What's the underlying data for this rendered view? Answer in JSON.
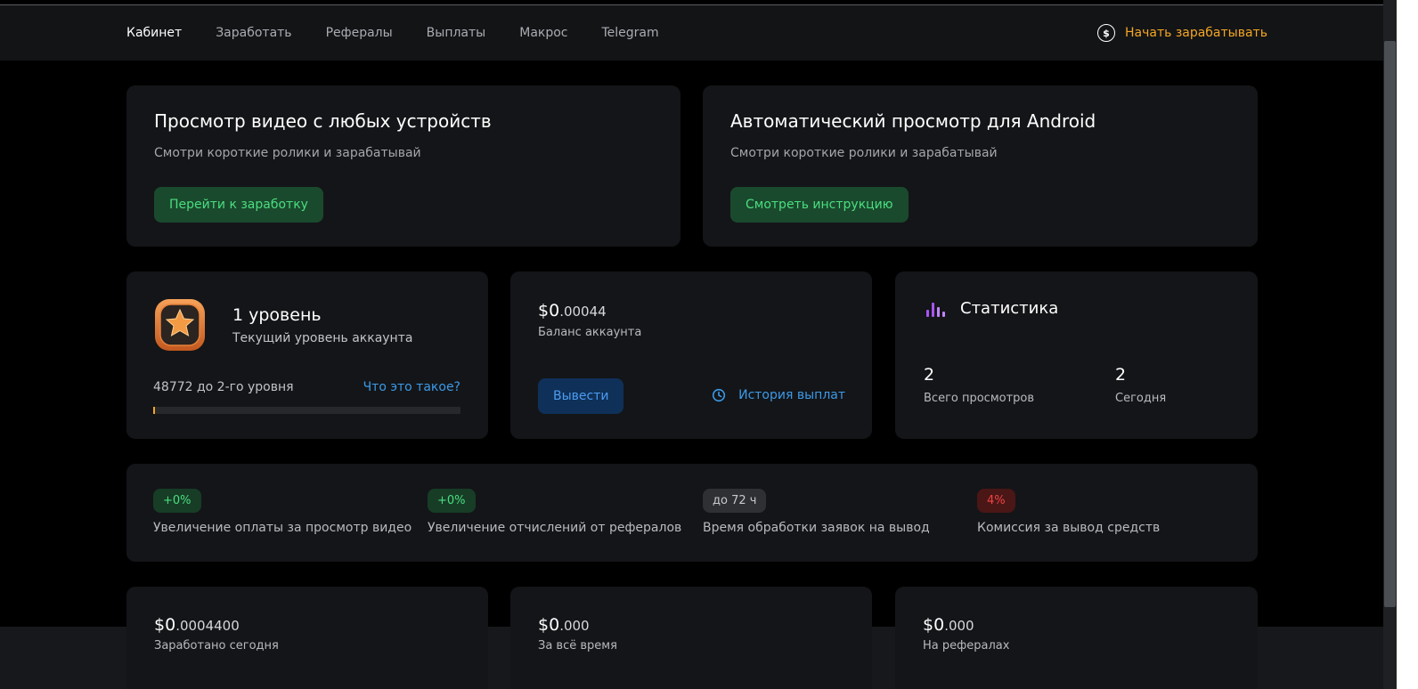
{
  "nav": {
    "items": [
      "Кабинет",
      "Заработать",
      "Рефералы",
      "Выплаты",
      "Макрос",
      "Telegram"
    ],
    "cta_label": "Начать зарабатывать",
    "cta_icon": "dollar-circle-icon"
  },
  "promo": [
    {
      "title": "Просмотр видео с любых устройств",
      "subtitle": "Смотри короткие ролики и зарабатывай",
      "button": "Перейти к заработку"
    },
    {
      "title": "Автоматический просмотр для Android",
      "subtitle": "Смотри короткие ролики и зарабатывай",
      "button": "Смотреть инструкцию"
    }
  ],
  "level": {
    "title": "1 уровень",
    "subtitle": "Текущий уровень аккаунта",
    "progress_text": "48772 до 2-го уровня",
    "help_link": "Что это такое?",
    "progress_fraction": 0.004,
    "icon": "star-badge-icon"
  },
  "balance": {
    "main": "$0",
    "frac": ".00044",
    "label": "Баланс аккаунта",
    "withdraw": "Вывести",
    "history": "История выплат"
  },
  "stats": {
    "title": "Статистика",
    "total_views": "2",
    "total_views_label": "Всего просмотров",
    "today": "2",
    "today_label": "Сегодня"
  },
  "features": [
    {
      "badge": "+0%",
      "label": "Увеличение оплаты за просмотр видео"
    },
    {
      "badge": "+0%",
      "label": "Увеличение отчислений от рефералов"
    },
    {
      "badge": "до 72 ч",
      "label": "Время обработки заявок на вывод"
    },
    {
      "badge": "4%",
      "label": "Комиссия за вывод средств"
    }
  ],
  "earnings": [
    {
      "main": "$0",
      "frac": ".0004400",
      "label": "Заработано сегодня"
    },
    {
      "main": "$0",
      "frac": ".000",
      "label": "За всё время"
    },
    {
      "main": "$0",
      "frac": ".000",
      "label": "На рефералах"
    }
  ],
  "colors": {
    "accent": "#f5a623",
    "green": "#4ade80",
    "blue": "#3b9ae8",
    "red": "#ef4444",
    "purple": "#a855f7"
  }
}
